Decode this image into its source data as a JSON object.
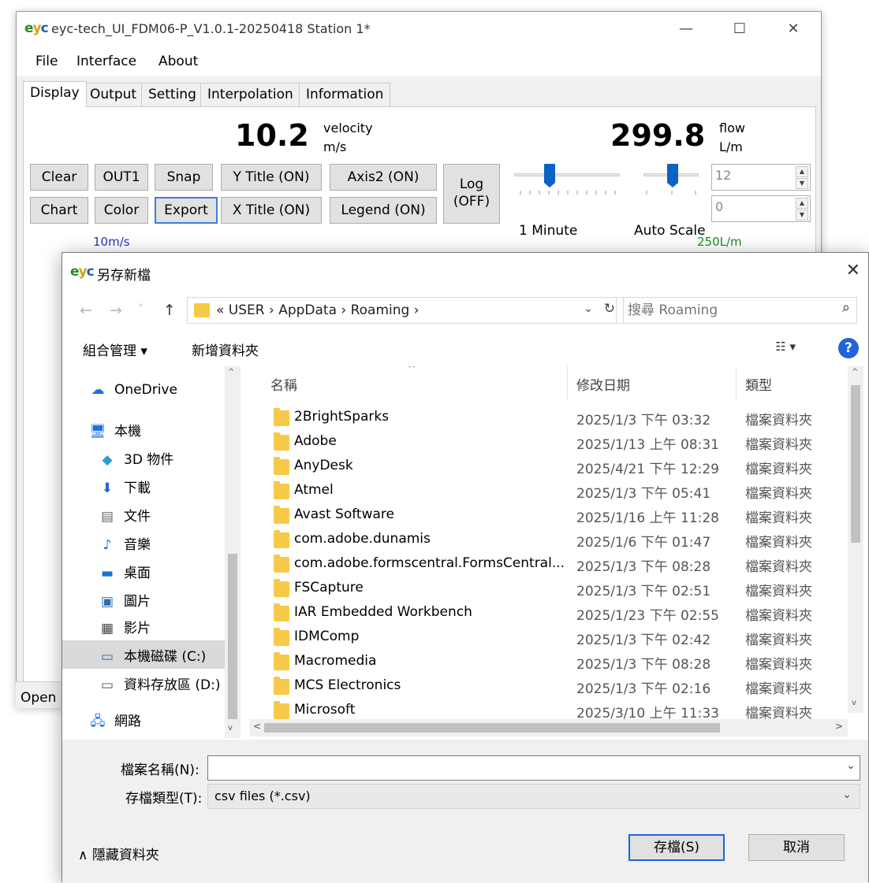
{
  "main_window": {
    "title": "eyc-tech_UI_FDM06-P_V1.0.1-20250418  Station 1*",
    "logo_text": "eyc",
    "window_controls": {
      "minimize": "—",
      "maximize": "☐",
      "close": "✕"
    },
    "menu": [
      {
        "label": "File"
      },
      {
        "label": "Interface"
      },
      {
        "label": "About"
      }
    ],
    "tabs": [
      "Display",
      "Output",
      "Setting",
      "Interpolation",
      "Information"
    ],
    "active_tab": "Display",
    "velocity": {
      "value": "10.2",
      "label": "velocity",
      "unit": "m/s"
    },
    "flow": {
      "value": "299.8",
      "label": "flow",
      "unit": "L/m"
    },
    "buttons": {
      "clear": "Clear",
      "out1": "OUT1",
      "snap": "Snap",
      "y_title": "Y Title (ON)",
      "axis2": "Axis2 (ON)",
      "chart": "Chart",
      "color": "Color",
      "export": "Export",
      "x_title": "X Title (ON)",
      "legend": "Legend (ON)",
      "log_line1": "Log",
      "log_line2": "(OFF)"
    },
    "sliders": {
      "time_label": "1 Minute",
      "scale_label": "Auto Scale"
    },
    "spinners": {
      "top_value": "12",
      "bottom_value": "0"
    },
    "chart_glimpse": {
      "left_label": "10m/s",
      "right_label": "250L/m"
    },
    "status_text": "Open"
  },
  "dialog": {
    "title": "另存新檔",
    "close": "✕",
    "nav": {
      "back": "←",
      "forward": "→",
      "recent": "˅",
      "up": "↑"
    },
    "address": "«  USER  ›  AppData  ›  Roaming  ›",
    "address_dropdown": "⌄",
    "refresh": "↻",
    "search_placeholder": "搜尋 Roaming",
    "toolbar": {
      "organize": "組合管理 ▾",
      "new_folder": "新增資料夾",
      "view": "☷ ▾",
      "help": "?"
    },
    "nav_pane": [
      {
        "label": "OneDrive",
        "icon": "cloud-icon",
        "glyph": "☁"
      },
      {
        "label": "本機",
        "icon": "computer-icon",
        "glyph": "🖥"
      },
      {
        "label": "3D 物件",
        "icon": "cube-icon",
        "glyph": "◆"
      },
      {
        "label": "下載",
        "icon": "download-icon",
        "glyph": "⬇"
      },
      {
        "label": "文件",
        "icon": "document-icon",
        "glyph": "▤"
      },
      {
        "label": "音樂",
        "icon": "music-icon",
        "glyph": "♪"
      },
      {
        "label": "桌面",
        "icon": "desktop-icon",
        "glyph": "▬"
      },
      {
        "label": "圖片",
        "icon": "picture-icon",
        "glyph": "▣"
      },
      {
        "label": "影片",
        "icon": "video-icon",
        "glyph": "▦"
      },
      {
        "label": "本機磁碟 (C:)",
        "icon": "drive-icon",
        "glyph": "▭"
      },
      {
        "label": "資料存放區 (D:)",
        "icon": "drive-icon",
        "glyph": "▭"
      },
      {
        "label": "網路",
        "icon": "network-icon",
        "glyph": "🖧"
      }
    ],
    "columns": {
      "name": "名稱",
      "date": "修改日期",
      "type": "類型"
    },
    "files": [
      {
        "name": "2BrightSparks",
        "date": "2025/1/3 下午 03:32",
        "type": "檔案資料夾"
      },
      {
        "name": "Adobe",
        "date": "2025/1/13 上午 08:31",
        "type": "檔案資料夾"
      },
      {
        "name": "AnyDesk",
        "date": "2025/4/21 下午 12:29",
        "type": "檔案資料夾"
      },
      {
        "name": "Atmel",
        "date": "2025/1/3 下午 05:41",
        "type": "檔案資料夾"
      },
      {
        "name": "Avast Software",
        "date": "2025/1/16 上午 11:28",
        "type": "檔案資料夾"
      },
      {
        "name": "com.adobe.dunamis",
        "date": "2025/1/6 下午 01:47",
        "type": "檔案資料夾"
      },
      {
        "name": "com.adobe.formscentral.FormsCentral...",
        "date": "2025/1/3 下午 08:28",
        "type": "檔案資料夾"
      },
      {
        "name": "FSCapture",
        "date": "2025/1/3 下午 02:51",
        "type": "檔案資料夾"
      },
      {
        "name": "IAR Embedded Workbench",
        "date": "2025/1/23 下午 02:55",
        "type": "檔案資料夾"
      },
      {
        "name": "IDMComp",
        "date": "2025/1/3 下午 02:42",
        "type": "檔案資料夾"
      },
      {
        "name": "Macromedia",
        "date": "2025/1/3 下午 08:28",
        "type": "檔案資料夾"
      },
      {
        "name": "MCS Electronics",
        "date": "2025/1/3 下午 02:16",
        "type": "檔案資料夾"
      },
      {
        "name": "Microsoft",
        "date": "2025/3/10 上午 11:33",
        "type": "檔案資料夾"
      }
    ],
    "filename_label": "檔案名稱(N):",
    "filename_value": "",
    "filetype_label": "存檔類型(T):",
    "filetype_value": "csv files (*.csv)",
    "hide_folders": "∧  隱藏資料夾",
    "save_button": "存檔(S)",
    "cancel_button": "取消"
  }
}
